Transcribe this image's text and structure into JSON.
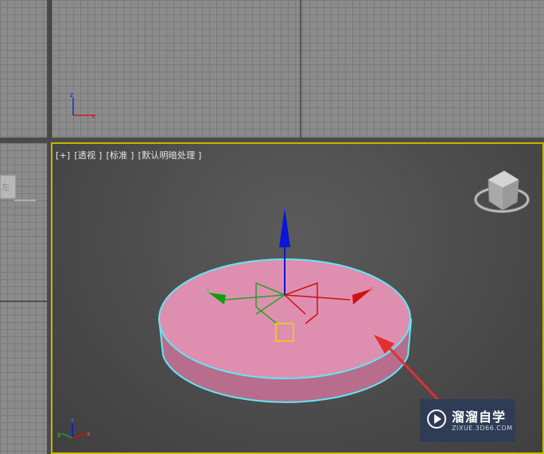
{
  "viewports": {
    "perspective": {
      "label_parts": [
        "[+]",
        "[透视 ]",
        "[标准 ]",
        "[默认明暗处理 ]"
      ]
    },
    "left": {
      "viewcube_label": "左"
    }
  },
  "axis_labels": {
    "x": "x",
    "y": "y",
    "z": "z"
  },
  "watermark": {
    "title": "溜溜自学",
    "subtitle": "ZIXUE.3D66.COM"
  },
  "colors": {
    "object_fill": "#de8fb0",
    "selection_outline": "#62e7f5",
    "viewport_border": "#c8b400",
    "axis_x": "#d01010",
    "axis_y": "#0ea010",
    "axis_z": "#0a16d8",
    "arrow": "#e03030"
  },
  "icons": [
    "viewcube-icon",
    "gizmo-icon",
    "arrow-annotation-icon",
    "watermark-logo-icon"
  ]
}
